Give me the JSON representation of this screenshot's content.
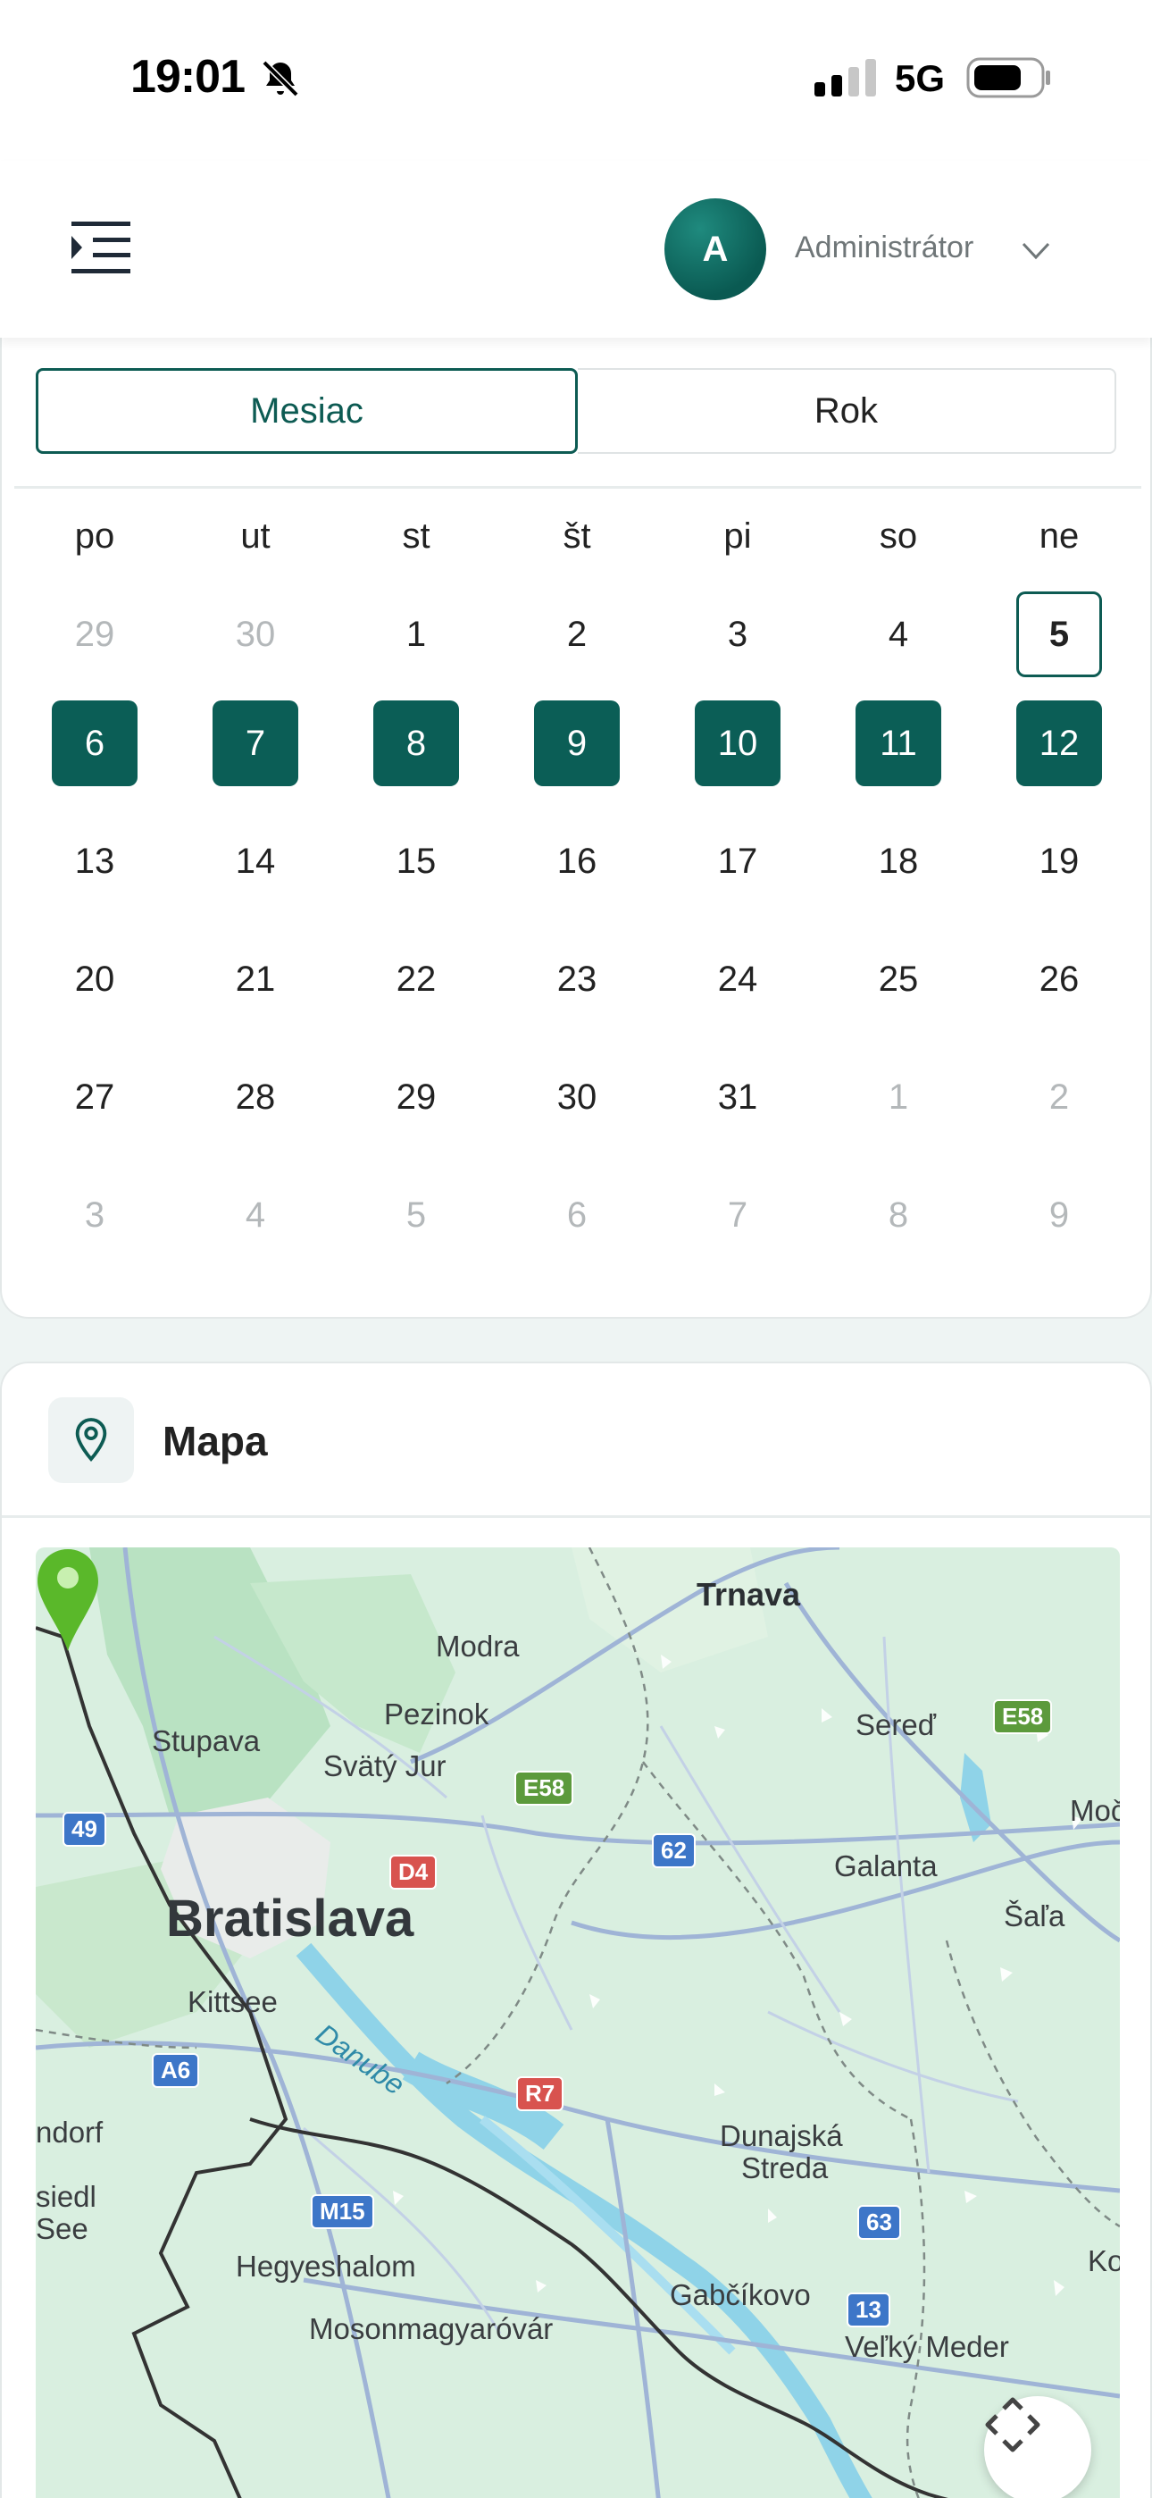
{
  "status_bar": {
    "time": "19:01",
    "network": "5G",
    "icons": [
      "bell-off-icon",
      "signal-icon",
      "battery-icon"
    ]
  },
  "header": {
    "menu_icon": "menu-indent-icon",
    "avatar_initial": "A",
    "user_name": "Administrátor",
    "chevron_icon": "chevron-down-icon"
  },
  "calendar": {
    "toggle": {
      "month_label": "Mesiac",
      "year_label": "Rok",
      "active": "month"
    },
    "weekdays": [
      "po",
      "ut",
      "st",
      "št",
      "pi",
      "so",
      "ne"
    ],
    "weeks": [
      [
        {
          "d": "29",
          "muted": true
        },
        {
          "d": "30",
          "muted": true
        },
        {
          "d": "1"
        },
        {
          "d": "2"
        },
        {
          "d": "3"
        },
        {
          "d": "4"
        },
        {
          "d": "5",
          "today": true
        }
      ],
      [
        {
          "d": "6",
          "selected": true
        },
        {
          "d": "7",
          "selected": true
        },
        {
          "d": "8",
          "selected": true
        },
        {
          "d": "9",
          "selected": true
        },
        {
          "d": "10",
          "selected": true
        },
        {
          "d": "11",
          "selected": true
        },
        {
          "d": "12",
          "selected": true
        }
      ],
      [
        {
          "d": "13"
        },
        {
          "d": "14"
        },
        {
          "d": "15"
        },
        {
          "d": "16"
        },
        {
          "d": "17"
        },
        {
          "d": "18"
        },
        {
          "d": "19"
        }
      ],
      [
        {
          "d": "20"
        },
        {
          "d": "21"
        },
        {
          "d": "22"
        },
        {
          "d": "23"
        },
        {
          "d": "24"
        },
        {
          "d": "25"
        },
        {
          "d": "26"
        }
      ],
      [
        {
          "d": "27"
        },
        {
          "d": "28"
        },
        {
          "d": "29"
        },
        {
          "d": "30"
        },
        {
          "d": "31"
        },
        {
          "d": "1",
          "muted": true
        },
        {
          "d": "2",
          "muted": true
        }
      ],
      [
        {
          "d": "3",
          "muted": true
        },
        {
          "d": "4",
          "muted": true
        },
        {
          "d": "5",
          "muted": true
        },
        {
          "d": "6",
          "muted": true
        },
        {
          "d": "7",
          "muted": true
        },
        {
          "d": "8",
          "muted": true
        },
        {
          "d": "9",
          "muted": true
        }
      ]
    ],
    "colors": {
      "accent": "#0b5e56",
      "muted": "#b4b8ba"
    }
  },
  "map": {
    "title": "Mapa",
    "title_icon": "location-pin-icon",
    "recenter_icon": "recenter-icon",
    "marker_color": "#5ab82a",
    "places": {
      "trnava": "Trnava",
      "modra": "Modra",
      "pezinok": "Pezinok",
      "stupava": "Stupava",
      "svaty_jur": "Svätý Jur",
      "sered": "Sereď",
      "mocen": "Močen",
      "galanta": "Galanta",
      "sala": "Šaľa",
      "bratislava": "Bratislava",
      "kittsee": "Kittsee",
      "danube": "Danube",
      "dunajska_1": "Dunajská",
      "dunajska_2": "Streda",
      "ndorf": "ndorf",
      "siedl": "siedl",
      "see": "See",
      "hegyeshalom": "Hegyeshalom",
      "mosonmagyarovar": "Mosonmagyaróvár",
      "gabcikovo": "Gabčíkovo",
      "velky_meder": "Veľký Meder",
      "ko": "Ko"
    },
    "roads": {
      "e58_a": "E58",
      "e58_b": "E58",
      "r49": "49",
      "r62": "62",
      "d4": "D4",
      "a6": "A6",
      "r7": "R7",
      "m15": "M15",
      "r63": "63",
      "r13": "13"
    }
  }
}
